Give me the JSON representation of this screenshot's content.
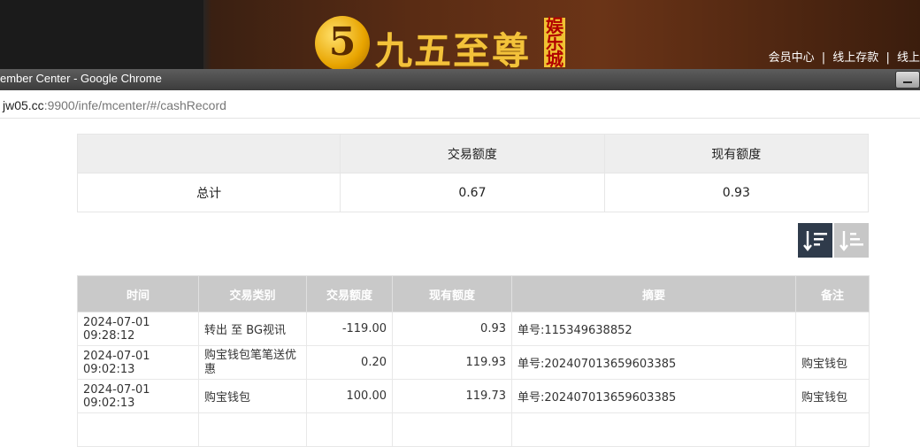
{
  "banner": {
    "logo_mark": "5",
    "logo_text": "九五至尊",
    "logo_badge": "娱乐城",
    "top_links": [
      "会员中心",
      "线上存款",
      "线上"
    ],
    "separator": "|"
  },
  "window": {
    "title": "ember Center - Google Chrome",
    "url_host": "jw05.cc",
    "url_rest": ":9900/infe/mcenter/#/cashRecord"
  },
  "summary": {
    "headers": [
      "",
      "交易额度",
      "现有额度"
    ],
    "row": {
      "label": "总计",
      "trade": "0.67",
      "current": "0.93"
    }
  },
  "records": {
    "headers": [
      "时间",
      "交易类别",
      "交易额度",
      "现有额度",
      "摘要",
      "备注"
    ],
    "rows": [
      {
        "time": "2024-07-01 09:28:12",
        "type": "转出 至 BG视讯",
        "amount": "-119.00",
        "balance": "0.93",
        "summary": "单号:115349638852",
        "note": ""
      },
      {
        "time": "2024-07-01 09:02:13",
        "type": "购宝钱包笔笔送优惠",
        "amount": "0.20",
        "balance": "119.93",
        "summary": "单号:202407013659603385",
        "note": "购宝钱包"
      },
      {
        "time": "2024-07-01 09:02:13",
        "type": "购宝钱包",
        "amount": "100.00",
        "balance": "119.73",
        "summary": "单号:202407013659603385",
        "note": "购宝钱包"
      }
    ]
  },
  "colors": {
    "sort_active": "#2f3b4b",
    "sort_inactive": "#c7c7c7",
    "table_header": "#c9c9c9"
  }
}
